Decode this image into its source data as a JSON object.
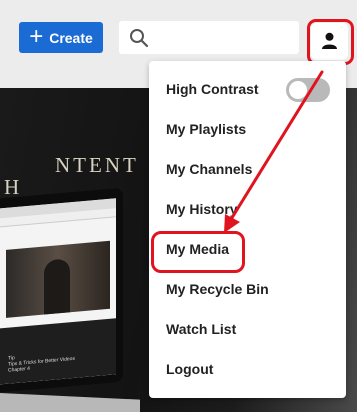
{
  "toolbar": {
    "create_label": "Create",
    "create_icon": "plus-icon",
    "search_icon": "search-icon",
    "search_placeholder": "",
    "user_icon": "user-icon",
    "accent_color": "#1b6bd4"
  },
  "user_menu": {
    "items": [
      {
        "label": "High Contrast",
        "type": "toggle",
        "toggle_on": false
      },
      {
        "label": "My Playlists"
      },
      {
        "label": "My Channels"
      },
      {
        "label": "My History"
      },
      {
        "label": "My Media"
      },
      {
        "label": "My Recycle Bin"
      },
      {
        "label": "Watch List"
      },
      {
        "label": "Logout"
      }
    ]
  },
  "hero": {
    "text_line1": "NTENT",
    "text_line2": "H",
    "thumb_caption_line1": "Tip",
    "thumb_caption_line2": "Tips & Tricks for Better Videos",
    "thumb_caption_line3": "Chapter 4"
  },
  "annotation": {
    "color": "#e0141e",
    "highlighted_item": "My Media"
  }
}
